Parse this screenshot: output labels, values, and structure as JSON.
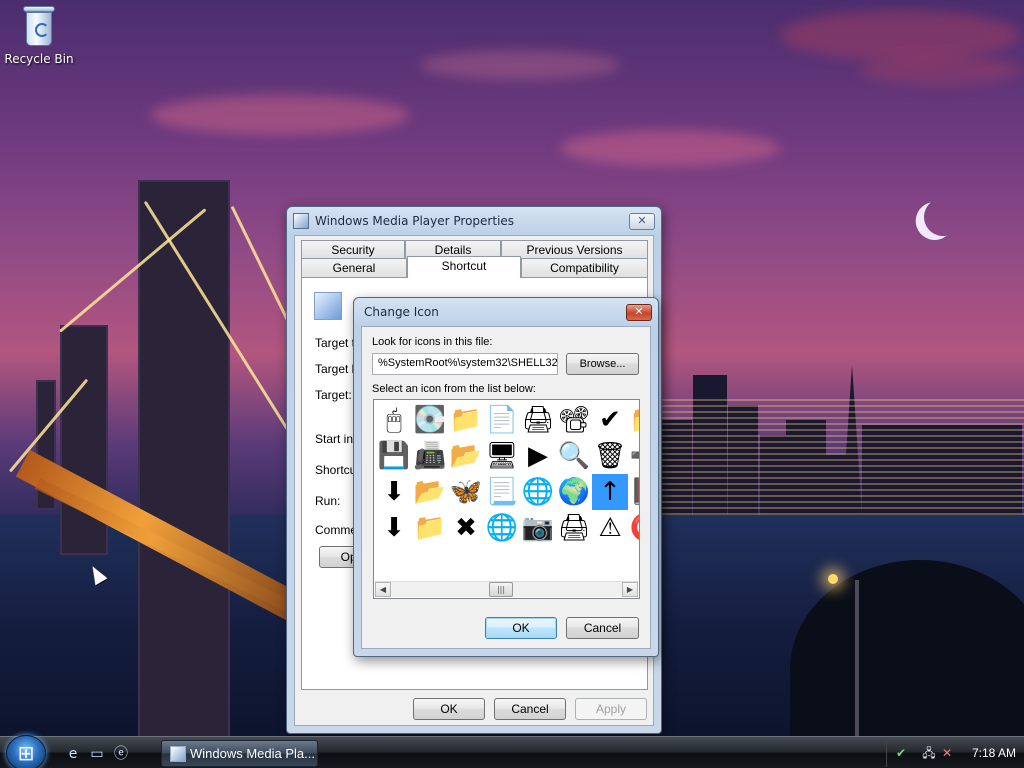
{
  "desktop": {
    "recycle_bin_label": "Recycle Bin"
  },
  "properties_dialog": {
    "title": "Windows Media Player Properties",
    "tabs_row1": [
      "Security",
      "Details",
      "Previous Versions"
    ],
    "tabs_row2": [
      "General",
      "Shortcut",
      "Compatibility"
    ],
    "active_tab": "Shortcut",
    "labels": {
      "target_type": "Target ty",
      "target_location": "Target lo",
      "target": "Target:",
      "start_in": "Start in:",
      "shortcut_key": "Shortcut",
      "run": "Run:",
      "comment": "Commen",
      "open_button": "Oper"
    },
    "buttons": {
      "ok": "OK",
      "cancel": "Cancel",
      "apply": "Apply"
    }
  },
  "change_icon_dialog": {
    "title": "Change Icon",
    "look_for_label": "Look for icons in this file:",
    "file_path": "%SystemRoot%\\system32\\SHELL32",
    "browse_button": "Browse...",
    "select_label": "Select an icon from the list below:",
    "icons": [
      [
        "mouse-icon",
        "drive-icon",
        "music-folder-icon",
        "document-arrow-icon",
        "printer-icon",
        "projector-icon",
        "checkmark-icon",
        "folder-icon"
      ],
      [
        "tablet-icon",
        "scanner-icon",
        "document-folder-icon",
        "network-adapter-icon",
        "play-icon",
        "search-icon",
        "recycle-bin-icon",
        "add-icon"
      ],
      [
        "download-arrow-icon",
        "open-folder-icon",
        "butterfly-icon",
        "pages-icon",
        "globe-icon",
        "internet-globe-icon",
        "up-arrow-icon",
        "partial-icon"
      ],
      [
        "small-download-icon",
        "photo-folder-icon",
        "red-x-icon",
        "globe-arrow-icon",
        "camera-icon",
        "printer-fax-icon",
        "folder-warning-icon",
        "partial-red-icon"
      ]
    ],
    "icon_glyphs": [
      [
        "🖱",
        "💽",
        "📁",
        "📄",
        "🖨",
        "📽",
        "✔",
        "📁"
      ],
      [
        "💾",
        "📠",
        "📂",
        "🖥",
        "▶",
        "🔍",
        "🗑",
        "➕"
      ],
      [
        "⬇",
        "📂",
        "🦋",
        "📃",
        "🌐",
        "🌍",
        "↑",
        "📕"
      ],
      [
        "⬇",
        "📁",
        "✖",
        "🌐",
        "📷",
        "🖨",
        "⚠",
        "⭕"
      ]
    ],
    "selected_icon": "up-arrow-icon",
    "scroll_thumb_glyph": "|||",
    "buttons": {
      "ok": "OK",
      "cancel": "Cancel"
    }
  },
  "taskbar": {
    "active_task": "Windows Media Pla...",
    "clock": "7:18 AM"
  },
  "colors": {
    "selection": "#3399ff",
    "close_button": "#c6452d",
    "default_button_border": "#3c7fb1"
  }
}
